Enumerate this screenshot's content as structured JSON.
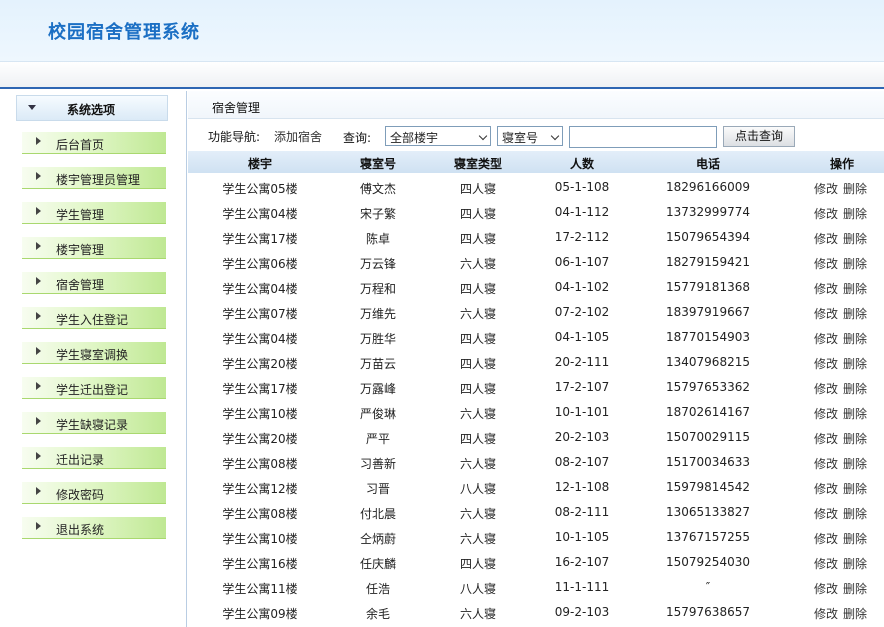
{
  "app": {
    "title": "校园宿舍管理系统"
  },
  "sidebar": {
    "header": "系统选项",
    "items": [
      "后台首页",
      "楼宇管理员管理",
      "学生管理",
      "楼宇管理",
      "宿舍管理",
      "学生入住登记",
      "学生寝室调换",
      "学生迁出登记",
      "学生缺寝记录",
      "迁出记录",
      "修改密码",
      "退出系统"
    ]
  },
  "breadcrumb": "宿舍管理",
  "toolbar": {
    "nav_label": "功能导航:",
    "add_link": "添加宿舍",
    "query_label": "查询:",
    "building_select": "全部楼宇",
    "room_select": "寝室号",
    "search_value": "",
    "query_button": "点击查询"
  },
  "table": {
    "headers": [
      "楼宇",
      "寝室号",
      "寝室类型",
      "人数",
      "电话",
      "操作"
    ],
    "edit_label": "修改",
    "delete_label": "删除",
    "rows": [
      [
        "学生公寓05楼",
        "傅文杰",
        "四人寝",
        "05-1-108",
        "18296166009"
      ],
      [
        "学生公寓04楼",
        "宋子繁",
        "四人寝",
        "04-1-112",
        "13732999774"
      ],
      [
        "学生公寓17楼",
        "陈卓",
        "四人寝",
        "17-2-112",
        "15079654394"
      ],
      [
        "学生公寓06楼",
        "万云锋",
        "六人寝",
        "06-1-107",
        "18279159421"
      ],
      [
        "学生公寓04楼",
        "万程和",
        "四人寝",
        "04-1-102",
        "15779181368"
      ],
      [
        "学生公寓07楼",
        "万维先",
        "六人寝",
        "07-2-102",
        "18397919667"
      ],
      [
        "学生公寓04楼",
        "万胜华",
        "四人寝",
        "04-1-105",
        "18770154903"
      ],
      [
        "学生公寓20楼",
        "万苗云",
        "四人寝",
        "20-2-111",
        "13407968215"
      ],
      [
        "学生公寓17楼",
        "万露峰",
        "四人寝",
        "17-2-107",
        "15797653362"
      ],
      [
        "学生公寓10楼",
        "严俊琳",
        "六人寝",
        "10-1-101",
        "18702614167"
      ],
      [
        "学生公寓20楼",
        "严平",
        "四人寝",
        "20-2-103",
        "15070029115"
      ],
      [
        "学生公寓08楼",
        "习善新",
        "六人寝",
        "08-2-107",
        "15170034633"
      ],
      [
        "学生公寓12楼",
        "习晋",
        "八人寝",
        "12-1-108",
        "15979814542"
      ],
      [
        "学生公寓08楼",
        "付北晨",
        "六人寝",
        "08-2-111",
        "13065133827"
      ],
      [
        "学生公寓10楼",
        "仝炳蔚",
        "六人寝",
        "10-1-105",
        "13767157255"
      ],
      [
        "学生公寓16楼",
        "任庆麟",
        "四人寝",
        "16-2-107",
        "15079254030"
      ],
      [
        "学生公寓11楼",
        "任浩",
        "八人寝",
        "11-1-111",
        "″"
      ],
      [
        "学生公寓09楼",
        "余毛",
        "六人寝",
        "09-2-103",
        "15797638657"
      ]
    ]
  }
}
